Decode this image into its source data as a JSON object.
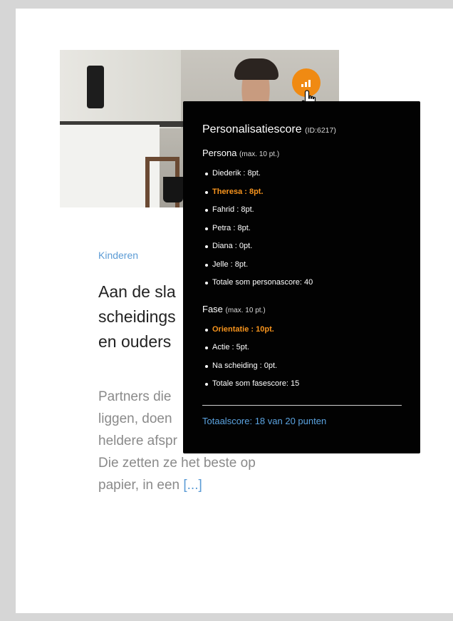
{
  "article": {
    "category": "Kinderen",
    "title_lines": [
      "Aan de sla",
      "scheidings",
      "en ouders"
    ],
    "excerpt_lines": [
      "Partners die",
      "liggen, doen",
      "heldere afspr",
      "Die zetten ze het beste op",
      "papier, in een"
    ],
    "readmore": "[...]"
  },
  "badge": {
    "icon": "bar-chart-icon",
    "color": "#f08a12"
  },
  "tooltip": {
    "title": "Personalisatiescore",
    "id_text": "(ID:6217)",
    "persona": {
      "title": "Persona",
      "note": "(max. 10 pt.)",
      "items": [
        {
          "text": "Diederik : 8pt.",
          "highlight": false
        },
        {
          "text": "Theresa : 8pt.",
          "highlight": true
        },
        {
          "text": "Fahrid : 8pt.",
          "highlight": false
        },
        {
          "text": "Petra : 8pt.",
          "highlight": false
        },
        {
          "text": "Diana : 0pt.",
          "highlight": false
        },
        {
          "text": "Jelle : 8pt.",
          "highlight": false
        },
        {
          "text": "Totale som personascore: 40",
          "highlight": false
        }
      ]
    },
    "fase": {
      "title": "Fase",
      "note": "(max. 10 pt.)",
      "items": [
        {
          "text": "Orientatie : 10pt.",
          "highlight": true
        },
        {
          "text": "Actie : 5pt.",
          "highlight": false
        },
        {
          "text": "Na scheiding : 0pt.",
          "highlight": false
        },
        {
          "text": "Totale som fasescore: 15",
          "highlight": false
        }
      ]
    },
    "total": "Totaalscore: 18 van 20 punten"
  },
  "colors": {
    "highlight": "#f7941d",
    "link": "#5ba3e0",
    "tooltip_bg": "#020202"
  }
}
